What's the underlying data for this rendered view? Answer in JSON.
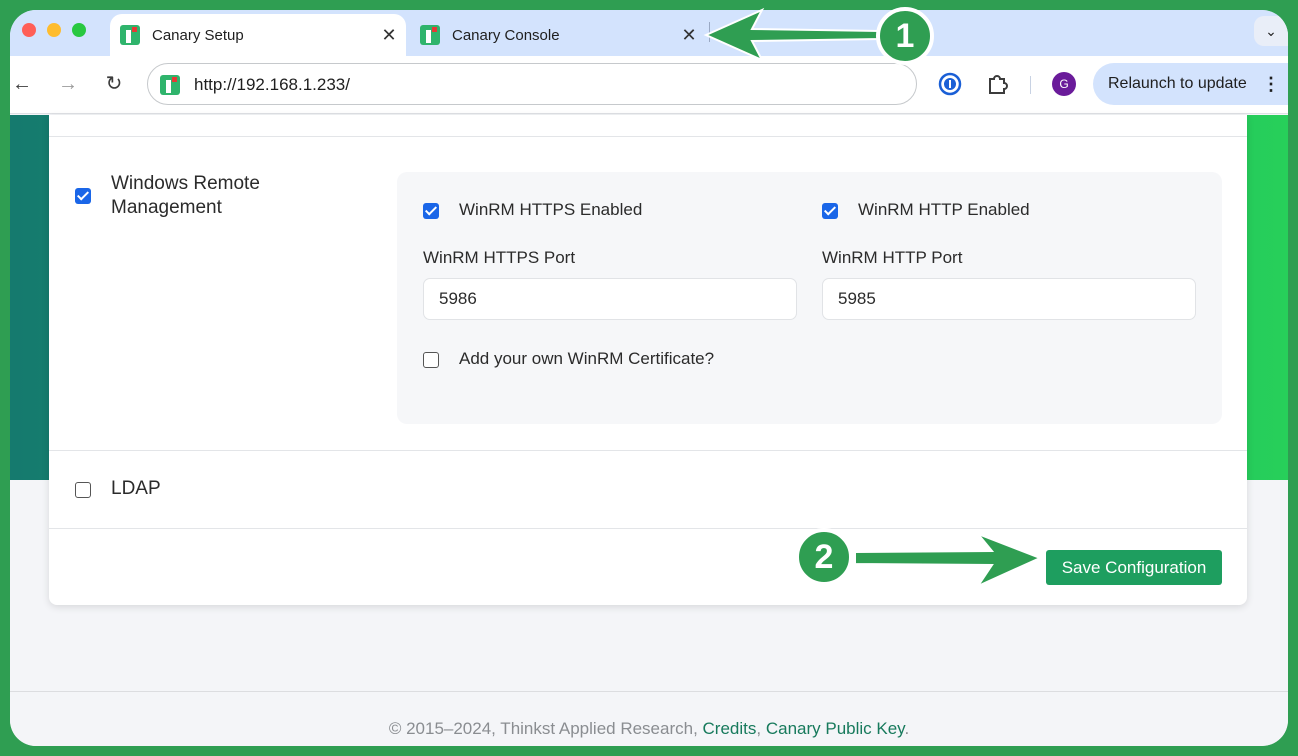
{
  "browser": {
    "tabs": [
      {
        "title": "Canary Setup",
        "active": true
      },
      {
        "title": "Canary Console",
        "active": false
      }
    ],
    "url": "http://192.168.1.233/",
    "avatar_initial": "G",
    "relaunch_label": "Relaunch to update"
  },
  "form": {
    "winrm": {
      "label": "Windows Remote Management",
      "checked": true,
      "https_enabled_label": "WinRM HTTPS Enabled",
      "http_enabled_label": "WinRM HTTP Enabled",
      "https_port_label": "WinRM HTTPS Port",
      "https_port_value": "5986",
      "http_port_label": "WinRM HTTP Port",
      "http_port_value": "5985",
      "own_cert_label": "Add your own WinRM Certificate?"
    },
    "ldap": {
      "label": "LDAP",
      "checked": false
    },
    "save_label": "Save Configuration"
  },
  "footer": {
    "copyright": "© 2015–2024, Thinkst Applied Research, ",
    "credits_link": "Credits",
    "separator": ", ",
    "public_key_link": "Canary Public Key",
    "end": "."
  },
  "annotations": {
    "step1": "1",
    "step2": "2"
  },
  "colors": {
    "frame": "#2f9e52",
    "accent": "#1e9e5f",
    "checkbox": "#1a66e8"
  }
}
